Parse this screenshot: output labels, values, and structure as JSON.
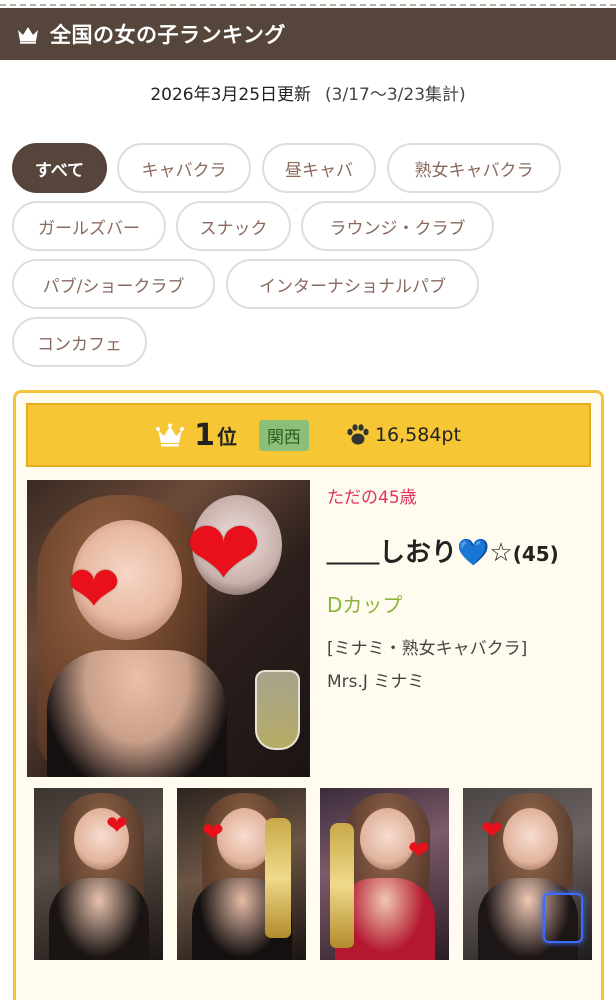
{
  "header": {
    "title": "全国の女の子ランキング",
    "crown_icon": "crown-icon"
  },
  "updated": {
    "date": "2026年3月25日更新",
    "range": "(3/17〜3/23集計)"
  },
  "categories": [
    {
      "label": "すべて",
      "active": true
    },
    {
      "label": "キャバクラ",
      "active": false
    },
    {
      "label": "昼キャバ",
      "active": false
    },
    {
      "label": "熟女キャバクラ",
      "active": false
    },
    {
      "label": "ガールズバー",
      "active": false
    },
    {
      "label": "スナック",
      "active": false
    },
    {
      "label": "ラウンジ・クラブ",
      "active": false
    },
    {
      "label": "パブ/ショークラブ",
      "active": false
    },
    {
      "label": "インターナショナルパブ",
      "active": false
    },
    {
      "label": "コンカフェ",
      "active": false
    }
  ],
  "ranking": [
    {
      "rank": "1",
      "rank_suffix": "位",
      "region": "関西",
      "points": "16,584pt",
      "catchphrase": "ただの45歳",
      "name": "＿＿しおり💙☆",
      "age": "(45)",
      "cup": "Dカップ",
      "shop_area_type": "[ミナミ・熟女キャバクラ]",
      "shop_name": "Mrs.J ミナミ",
      "thumbnails": [
        "photo-1",
        "photo-2",
        "photo-3",
        "photo-4"
      ]
    }
  ],
  "colors": {
    "header_bg": "#55453a",
    "chip_active_bg": "#55453a",
    "chip_text": "#8a6a5d",
    "rank_bar": "#f7c634",
    "card_bg": "#fffbee",
    "catch": "#e0335f",
    "cup": "#8ab63c",
    "region_badge": "#8bbf7a"
  }
}
